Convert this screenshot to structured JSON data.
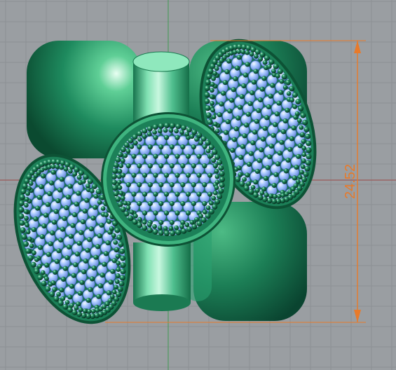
{
  "viewport": {
    "view": "cad-perspective-viewport",
    "background_color": "#9a9ea2",
    "grid_color": "#8c9094",
    "axis_x_color": "#9a5a5a",
    "axis_y_color": "#4f9a5f"
  },
  "model": {
    "object": "jewelry-pendant",
    "material_color": "#1e8a5e",
    "gem_color": "#a8c8ff",
    "bead_color": "#0f5c3c"
  },
  "dimension": {
    "label": "24.52",
    "color": "#e87a2a"
  }
}
